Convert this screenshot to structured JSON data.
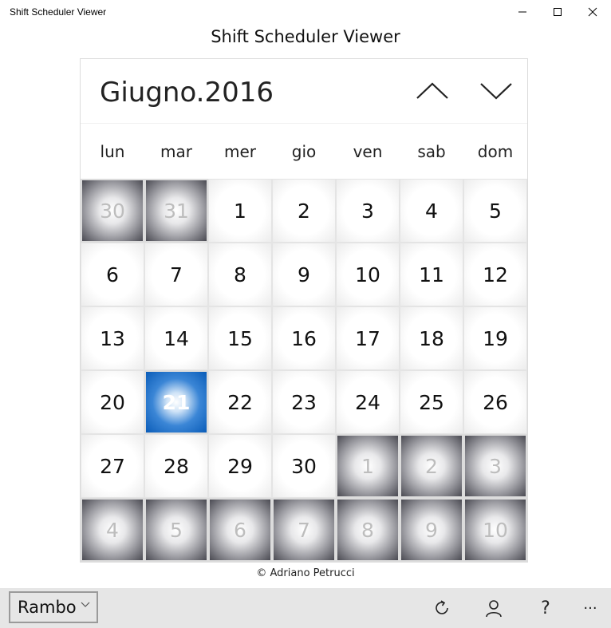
{
  "window": {
    "title": "Shift Scheduler Viewer",
    "minimize": "—",
    "maximize": "☐",
    "close": "✕"
  },
  "app": {
    "title": "Shift Scheduler Viewer"
  },
  "calendar": {
    "month_label": "Giugno.2016",
    "weekdays": [
      "lun",
      "mar",
      "mer",
      "gio",
      "ven",
      "sab",
      "dom"
    ],
    "days": [
      {
        "label": "30",
        "other": true
      },
      {
        "label": "31",
        "other": true
      },
      {
        "label": "1"
      },
      {
        "label": "2"
      },
      {
        "label": "3"
      },
      {
        "label": "4"
      },
      {
        "label": "5"
      },
      {
        "label": "6"
      },
      {
        "label": "7"
      },
      {
        "label": "8"
      },
      {
        "label": "9"
      },
      {
        "label": "10"
      },
      {
        "label": "11"
      },
      {
        "label": "12"
      },
      {
        "label": "13"
      },
      {
        "label": "14"
      },
      {
        "label": "15"
      },
      {
        "label": "16"
      },
      {
        "label": "17"
      },
      {
        "label": "18"
      },
      {
        "label": "19"
      },
      {
        "label": "20"
      },
      {
        "label": "21",
        "today": true
      },
      {
        "label": "22"
      },
      {
        "label": "23"
      },
      {
        "label": "24"
      },
      {
        "label": "25"
      },
      {
        "label": "26"
      },
      {
        "label": "27"
      },
      {
        "label": "28"
      },
      {
        "label": "29"
      },
      {
        "label": "30"
      },
      {
        "label": "1",
        "other": true
      },
      {
        "label": "2",
        "other": true
      },
      {
        "label": "3",
        "other": true
      },
      {
        "label": "4",
        "other": true
      },
      {
        "label": "5",
        "other": true
      },
      {
        "label": "6",
        "other": true
      },
      {
        "label": "7",
        "other": true
      },
      {
        "label": "8",
        "other": true
      },
      {
        "label": "9",
        "other": true
      },
      {
        "label": "10",
        "other": true
      }
    ]
  },
  "footer": {
    "credit": "© Adriano Petrucci"
  },
  "appbar": {
    "user_value": "Rambo",
    "help_label": "?",
    "more_label": "···",
    "icons": {
      "refresh": "refresh-icon",
      "user": "person-icon"
    }
  },
  "colors": {
    "today": "#0a5cb8",
    "other_month": "#4a4a52",
    "appbar": "#e6e6e6"
  }
}
